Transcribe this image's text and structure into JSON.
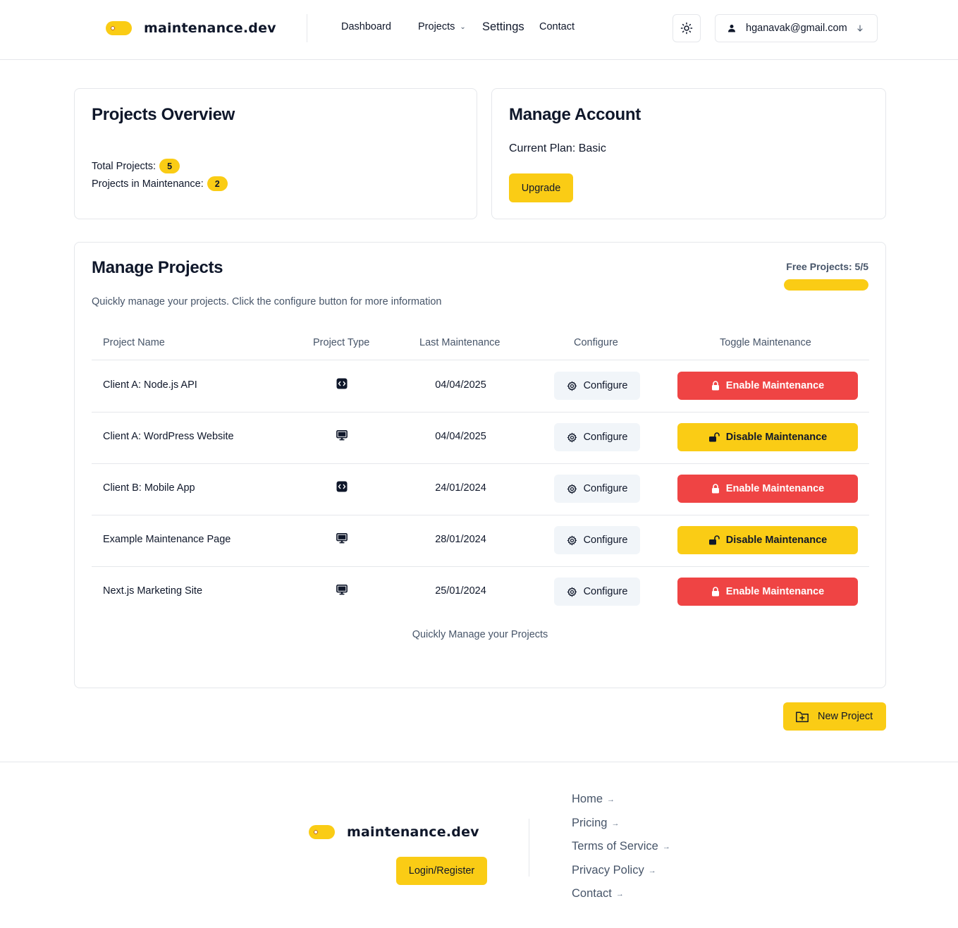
{
  "header": {
    "brand": "maintenance.dev",
    "nav": {
      "dashboard": "Dashboard",
      "projects": "Projects",
      "settings": "Settings",
      "contact": "Contact"
    },
    "user_email": "hganavak@gmail.com"
  },
  "overview": {
    "title": "Projects Overview",
    "total_label": "Total Projects:",
    "total_value": "5",
    "maint_label": "Projects in Maintenance:",
    "maint_value": "2"
  },
  "account": {
    "title": "Manage Account",
    "plan": "Current Plan: Basic",
    "upgrade_label": "Upgrade"
  },
  "manage": {
    "title": "Manage Projects",
    "subtitle": "Quickly manage your projects. Click the configure button for more information",
    "free_label": "Free Projects: 5/5",
    "free_used_fraction": 1.0,
    "columns": [
      "Project Name",
      "Project Type",
      "Last Maintenance",
      "Configure",
      "Toggle Maintenance"
    ],
    "configure_label": "Configure",
    "rows": [
      {
        "name": "Client A: Node.js API",
        "type_icon": "code-icon",
        "date": "04/04/2025",
        "toggle": "Enable Maintenance"
      },
      {
        "name": "Client A: WordPress Website",
        "type_icon": "monitor-icon",
        "date": "04/04/2025",
        "toggle": "Disable Maintenance"
      },
      {
        "name": "Client B: Mobile App",
        "type_icon": "code-icon",
        "date": "24/01/2024",
        "toggle": "Enable Maintenance"
      },
      {
        "name": "Example Maintenance Page",
        "type_icon": "monitor-icon",
        "date": "28/01/2024",
        "toggle": "Disable Maintenance"
      },
      {
        "name": "Next.js Marketing Site",
        "type_icon": "monitor-icon",
        "date": "25/01/2024",
        "toggle": "Enable Maintenance"
      }
    ],
    "caption": "Quickly Manage your Projects"
  },
  "new_project_label": "New Project",
  "footer": {
    "brand": "maintenance.dev",
    "login_label": "Login/Register",
    "links": [
      "Home",
      "Pricing",
      "Terms of Service",
      "Privacy Policy",
      "Contact"
    ]
  },
  "colors": {
    "accent": "#facc15",
    "danger": "#ef4444",
    "muted_text": "#475569",
    "border": "#e5e7eb"
  }
}
